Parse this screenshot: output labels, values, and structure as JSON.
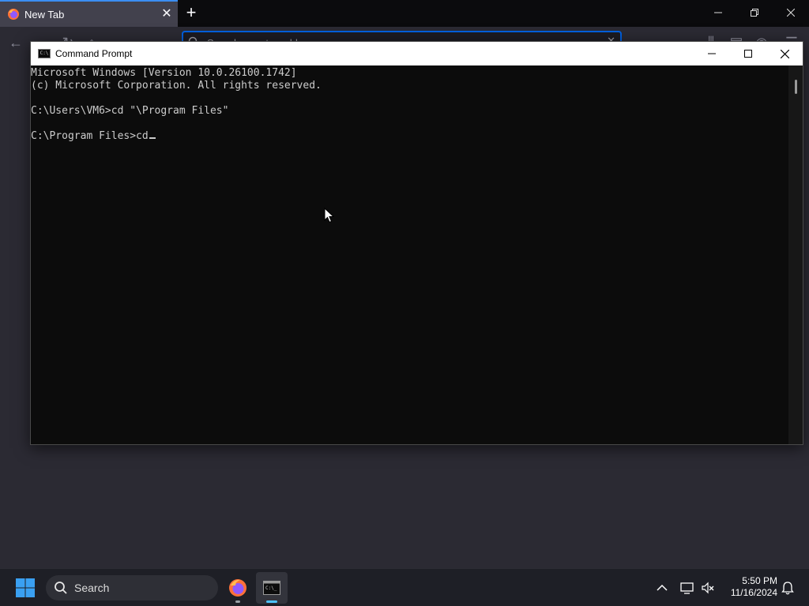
{
  "browser": {
    "tab_title": "New Tab",
    "urlbar_placeholder": "Search or enter address"
  },
  "cmd": {
    "title": "Command Prompt",
    "icon_text": "C:\\",
    "lines": [
      "Microsoft Windows [Version 10.0.26100.1742]",
      "(c) Microsoft Corporation. All rights reserved.",
      "",
      "C:\\Users\\VM6>cd \"\\Program Files\"",
      "",
      "C:\\Program Files>cd"
    ]
  },
  "taskbar": {
    "search_label": "Search",
    "time": "5:50 PM",
    "date": "11/16/2024"
  },
  "colors": {
    "accent": "#0060df",
    "cmd_bg": "#0c0c0c",
    "cmd_text": "#cccccc",
    "taskbar_bg": "#1e1f26"
  }
}
